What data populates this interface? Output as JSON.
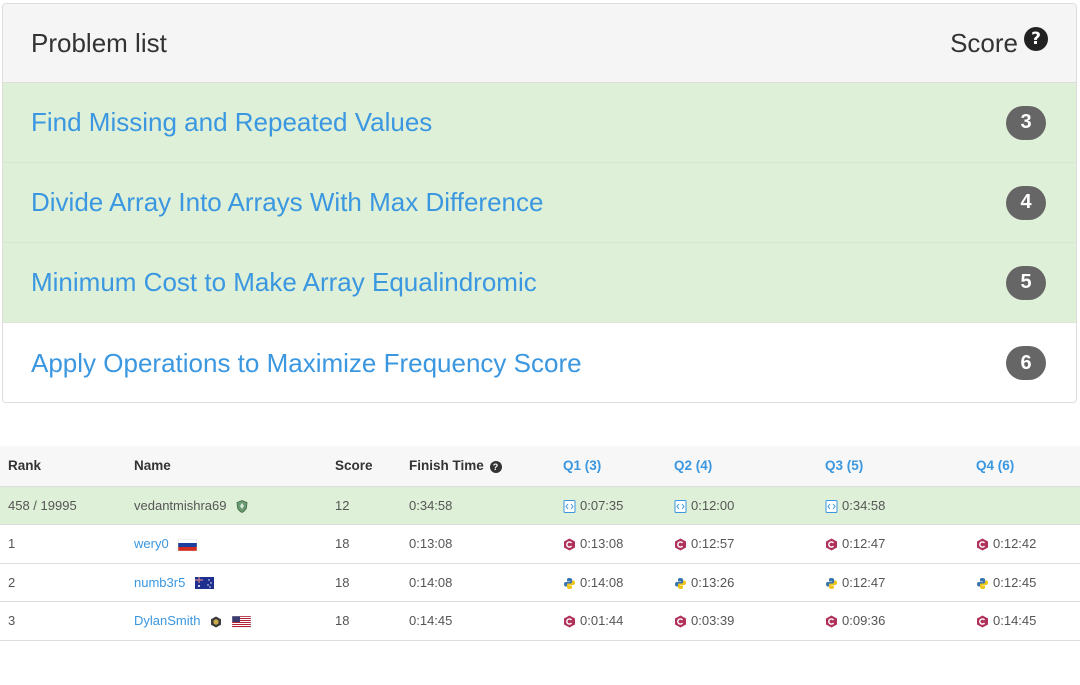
{
  "problems": {
    "title": "Problem list",
    "score_label": "Score",
    "help_glyph": "?",
    "items": [
      {
        "title": "Find Missing and Repeated Values",
        "score": "3",
        "solved": true
      },
      {
        "title": "Divide Array Into Arrays With Max Difference",
        "score": "4",
        "solved": true
      },
      {
        "title": "Minimum Cost to Make Array Equalindromic",
        "score": "5",
        "solved": true
      },
      {
        "title": "Apply Operations to Maximize Frequency Score",
        "score": "6",
        "solved": false
      }
    ]
  },
  "ranking": {
    "headers": {
      "rank": "Rank",
      "name": "Name",
      "score": "Score",
      "finish_time": "Finish Time",
      "q1": "Q1 (3)",
      "q2": "Q2 (4)",
      "q3": "Q3 (5)",
      "q4": "Q4 (6)"
    },
    "rows": [
      {
        "rank": "458 / 19995",
        "name": "vedantmishra69",
        "score": "12",
        "finish": "0:34:58",
        "q1": "0:07:35",
        "q2": "0:12:00",
        "q3": "0:34:58",
        "q4": "",
        "lang": "cpp-file-icon",
        "self": true
      },
      {
        "rank": "1",
        "name": "wery0",
        "score": "18",
        "finish": "0:13:08",
        "q1": "0:13:08",
        "q2": "0:12:57",
        "q3": "0:12:47",
        "q4": "0:12:42",
        "lang": "cpp-icon",
        "flag": "russia-flag"
      },
      {
        "rank": "2",
        "name": "numb3r5",
        "score": "18",
        "finish": "0:14:08",
        "q1": "0:14:08",
        "q2": "0:13:26",
        "q3": "0:12:47",
        "q4": "0:12:45",
        "lang": "python-icon",
        "flag": "australia-flag"
      },
      {
        "rank": "3",
        "name": "DylanSmith",
        "score": "18",
        "finish": "0:14:45",
        "q1": "0:01:44",
        "q2": "0:03:39",
        "q3": "0:09:36",
        "q4": "0:14:45",
        "lang": "cpp-icon",
        "flag": "usa-flag"
      }
    ]
  },
  "colors": {
    "solved_bg": "#dff0d8",
    "link": "#3a97e0",
    "badge": "#666666",
    "cpp_icon": "#b0325a"
  }
}
